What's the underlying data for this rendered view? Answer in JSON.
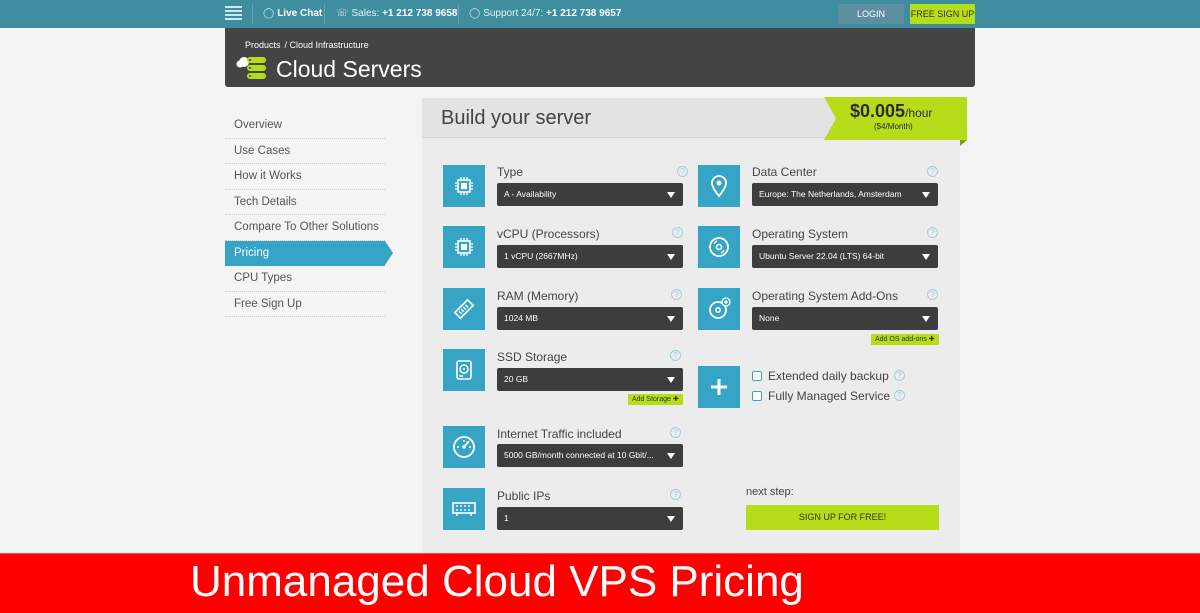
{
  "topbar": {
    "live_chat": "Live Chat",
    "sales_label": "Sales:",
    "sales_phone": "+1 212 738 9658",
    "support_label": "Support 24/7:",
    "support_phone": "+1 212 738 9657",
    "login": "LOGIN",
    "free_signup": "FREE SIGN UP"
  },
  "header": {
    "breadcrumb": [
      "Products",
      "/ Cloud Infrastructure"
    ],
    "title": "Cloud Servers"
  },
  "sidebar": {
    "items": [
      {
        "label": "Overview"
      },
      {
        "label": "Use Cases"
      },
      {
        "label": "How it Works"
      },
      {
        "label": "Tech Details"
      },
      {
        "label": "Compare To Other Solutions"
      },
      {
        "label": "Pricing",
        "active": true
      },
      {
        "label": "CPU Types"
      },
      {
        "label": "Free Sign Up"
      }
    ]
  },
  "builder": {
    "title": "Build your server",
    "price": "$0.005",
    "price_unit": "/hour",
    "price_month": "($4/Month)",
    "fields": {
      "type": {
        "label": "Type",
        "value": "A - Availability",
        "icon": "cpu-chip-icon"
      },
      "vcpu": {
        "label": "vCPU (Processors)",
        "value": "1 vCPU (2667MHz)",
        "icon": "cpu-chip-icon"
      },
      "ram": {
        "label": "RAM (Memory)",
        "value": "1024 MB",
        "icon": "memory-stick-icon"
      },
      "ssd": {
        "label": "SSD Storage",
        "value": "20 GB",
        "icon": "hard-drive-icon"
      },
      "traffic": {
        "label": "Internet Traffic included",
        "value": "5000 GB/month connected at 10 Gbit/...",
        "icon": "speedometer-icon"
      },
      "ips": {
        "label": "Public IPs",
        "value": "1",
        "icon": "network-card-icon"
      },
      "datacenter": {
        "label": "Data Center",
        "value": "Europe: The Netherlands, Amsterdam",
        "icon": "location-pin-icon"
      },
      "os": {
        "label": "Operating System",
        "value": "Ubuntu Server 22.04 (LTS) 64-bit",
        "icon": "disc-icon"
      },
      "os_addons": {
        "label": "Operating System Add-Ons",
        "value": "None",
        "icon": "disc-plus-icon"
      }
    },
    "add_storage": "Add Storage",
    "add_os_addons": "Add OS add-ons",
    "extras": {
      "backup": "Extended daily backup",
      "managed": "Fully Managed Service"
    },
    "next_step": "next step:",
    "signup_free": "SIGN UP FOR FREE!"
  },
  "banner": {
    "text": "Unmanaged Cloud VPS Pricing"
  },
  "colors": {
    "accent": "#36a4c5",
    "cta": "#b7dc1a",
    "topbar": "#3e8ea0",
    "banner": "#ff0000"
  }
}
